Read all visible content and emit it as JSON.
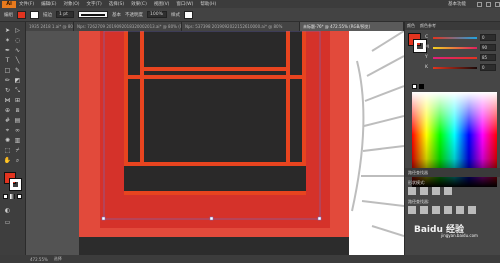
{
  "app": {
    "logo": "Ai"
  },
  "menu": [
    "文件(F)",
    "编辑(E)",
    "对象(O)",
    "文字(T)",
    "选择(S)",
    "效果(C)",
    "视图(V)",
    "窗口(W)",
    "帮助(H)"
  ],
  "workspace": "基本功能",
  "control_bar": {
    "selection_label": "编组",
    "stroke_label": "描边",
    "stroke_value": "1 pt",
    "brush_label": "基本",
    "opacity_label": "不透明度",
    "opacity_value": "100%",
    "style_label": "样式"
  },
  "tabs": [
    {
      "label": "1935 2418 1.ai* @ 80% (RGB/预览)",
      "active": false
    },
    {
      "label": "Nps: 7262709 2019092018320002013.ai* @ 80% (RGB/预览)",
      "active": false
    },
    {
      "label": "Nps: 537398 2019092022152610000.ai* @ 80%",
      "active": false
    },
    {
      "label": "未标题-76* @ 472.55% (RGB/预览)",
      "active": true
    }
  ],
  "color_panel": {
    "tab_label": "颜色",
    "tab2_label": "颜色参考",
    "channels": [
      {
        "name": "C",
        "value": "0"
      },
      {
        "name": "M",
        "value": "90"
      },
      {
        "name": "Y",
        "value": "85"
      },
      {
        "name": "K",
        "value": "0"
      }
    ]
  },
  "pathfinder_panel": {
    "tab_label": "路径查找器",
    "shape_modes_label": "形状模式:",
    "pathfinder_label": "路径查找器:"
  },
  "status_bar": {
    "zoom": "472.55%",
    "tool": "选择"
  },
  "watermark": {
    "text": "Baidu 经验",
    "sub": "jingyan.baidu.com"
  },
  "colors": {
    "frame_red": "#e24a3b",
    "inner_red": "#d5322a",
    "bar_red": "#e8441f",
    "dark": "#2a2929",
    "accent_fill": "#e2341f"
  }
}
